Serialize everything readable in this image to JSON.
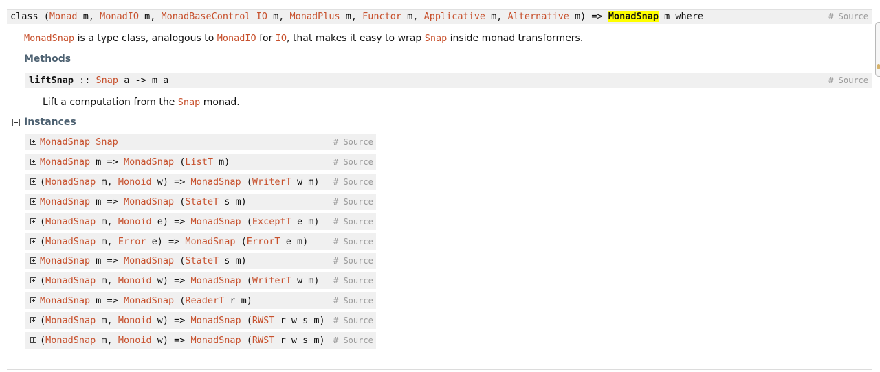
{
  "class_decl": {
    "keyword": "class",
    "open_paren": "(",
    "constraints": [
      {
        "class": "Monad",
        "args": " m"
      },
      {
        "class": "MonadIO",
        "args": " m"
      },
      {
        "class": "MonadBaseControl",
        "mid": " ",
        "class2": "IO",
        "args": " m"
      },
      {
        "class": "MonadPlus",
        "args": " m"
      },
      {
        "class": "Functor",
        "args": " m"
      },
      {
        "class": "Applicative",
        "args": " m"
      },
      {
        "class": "Alternative",
        "args": " m"
      }
    ],
    "separator": ", ",
    "close_paren_arrow": ") =>",
    "name": "MonadSnap",
    "tail": "m where",
    "source_label": "# Source"
  },
  "class_doc": {
    "part1": "MonadSnap",
    "part2": " is a type class, analogous to ",
    "part3": "MonadIO",
    "part4": " for ",
    "part5": "IO",
    "part6": ", that makes it easy to wrap ",
    "part7": "Snap",
    "part8": " inside monad transformers."
  },
  "methods": {
    "heading": "Methods",
    "name": "liftSnap",
    "sep": " :: ",
    "type_link": "Snap",
    "type_rest": " a -> m a",
    "source_label": "# Source",
    "doc_before": "Lift a computation from the ",
    "doc_link": "Snap",
    "doc_after": " monad."
  },
  "instances": {
    "heading": "Instances",
    "source_label": "# Source",
    "rows": [
      [
        {
          "t": "MonadSnap",
          "l": true
        },
        {
          "t": " ",
          "l": false
        },
        {
          "t": "Snap",
          "l": true
        }
      ],
      [
        {
          "t": "MonadSnap",
          "l": true
        },
        {
          "t": " m => ",
          "l": false
        },
        {
          "t": "MonadSnap",
          "l": true
        },
        {
          "t": " (",
          "l": false
        },
        {
          "t": "ListT",
          "l": true
        },
        {
          "t": " m)",
          "l": false
        }
      ],
      [
        {
          "t": "(",
          "l": false
        },
        {
          "t": "MonadSnap",
          "l": true
        },
        {
          "t": " m, ",
          "l": false
        },
        {
          "t": "Monoid",
          "l": true
        },
        {
          "t": " w) => ",
          "l": false
        },
        {
          "t": "MonadSnap",
          "l": true
        },
        {
          "t": " (",
          "l": false
        },
        {
          "t": "WriterT",
          "l": true
        },
        {
          "t": " w m)",
          "l": false
        }
      ],
      [
        {
          "t": "MonadSnap",
          "l": true
        },
        {
          "t": " m => ",
          "l": false
        },
        {
          "t": "MonadSnap",
          "l": true
        },
        {
          "t": " (",
          "l": false
        },
        {
          "t": "StateT",
          "l": true
        },
        {
          "t": " s m)",
          "l": false
        }
      ],
      [
        {
          "t": "(",
          "l": false
        },
        {
          "t": "MonadSnap",
          "l": true
        },
        {
          "t": " m, ",
          "l": false
        },
        {
          "t": "Monoid",
          "l": true
        },
        {
          "t": " e) => ",
          "l": false
        },
        {
          "t": "MonadSnap",
          "l": true
        },
        {
          "t": " (",
          "l": false
        },
        {
          "t": "ExceptT",
          "l": true
        },
        {
          "t": " e m)",
          "l": false
        }
      ],
      [
        {
          "t": "(",
          "l": false
        },
        {
          "t": "MonadSnap",
          "l": true
        },
        {
          "t": " m, ",
          "l": false
        },
        {
          "t": "Error",
          "l": true
        },
        {
          "t": " e) => ",
          "l": false
        },
        {
          "t": "MonadSnap",
          "l": true
        },
        {
          "t": " (",
          "l": false
        },
        {
          "t": "ErrorT",
          "l": true
        },
        {
          "t": " e m)",
          "l": false
        }
      ],
      [
        {
          "t": "MonadSnap",
          "l": true
        },
        {
          "t": " m => ",
          "l": false
        },
        {
          "t": "MonadSnap",
          "l": true
        },
        {
          "t": " (",
          "l": false
        },
        {
          "t": "StateT",
          "l": true
        },
        {
          "t": " s m)",
          "l": false
        }
      ],
      [
        {
          "t": "(",
          "l": false
        },
        {
          "t": "MonadSnap",
          "l": true
        },
        {
          "t": " m, ",
          "l": false
        },
        {
          "t": "Monoid",
          "l": true
        },
        {
          "t": " w) => ",
          "l": false
        },
        {
          "t": "MonadSnap",
          "l": true
        },
        {
          "t": " (",
          "l": false
        },
        {
          "t": "WriterT",
          "l": true
        },
        {
          "t": " w m)",
          "l": false
        }
      ],
      [
        {
          "t": "MonadSnap",
          "l": true
        },
        {
          "t": " m => ",
          "l": false
        },
        {
          "t": "MonadSnap",
          "l": true
        },
        {
          "t": " (",
          "l": false
        },
        {
          "t": "ReaderT",
          "l": true
        },
        {
          "t": " r m)",
          "l": false
        }
      ],
      [
        {
          "t": "(",
          "l": false
        },
        {
          "t": "MonadSnap",
          "l": true
        },
        {
          "t": " m, ",
          "l": false
        },
        {
          "t": "Monoid",
          "l": true
        },
        {
          "t": " w) => ",
          "l": false
        },
        {
          "t": "MonadSnap",
          "l": true
        },
        {
          "t": " (",
          "l": false
        },
        {
          "t": "RWST",
          "l": true
        },
        {
          "t": " r w s m)",
          "l": false
        }
      ],
      [
        {
          "t": "(",
          "l": false
        },
        {
          "t": "MonadSnap",
          "l": true
        },
        {
          "t": " m, ",
          "l": false
        },
        {
          "t": "Monoid",
          "l": true
        },
        {
          "t": " w) => ",
          "l": false
        },
        {
          "t": "MonadSnap",
          "l": true
        },
        {
          "t": " (",
          "l": false
        },
        {
          "t": "RWST",
          "l": true
        },
        {
          "t": " r w s m)",
          "l": false
        }
      ]
    ]
  },
  "colors": {
    "link": "#c7502c",
    "header_bg": "#f0f0f0",
    "section_heading": "#4e6272",
    "highlight": "#ffff00"
  },
  "icons": {
    "expand": "plus-box-icon",
    "collapse": "minus-box-icon"
  }
}
